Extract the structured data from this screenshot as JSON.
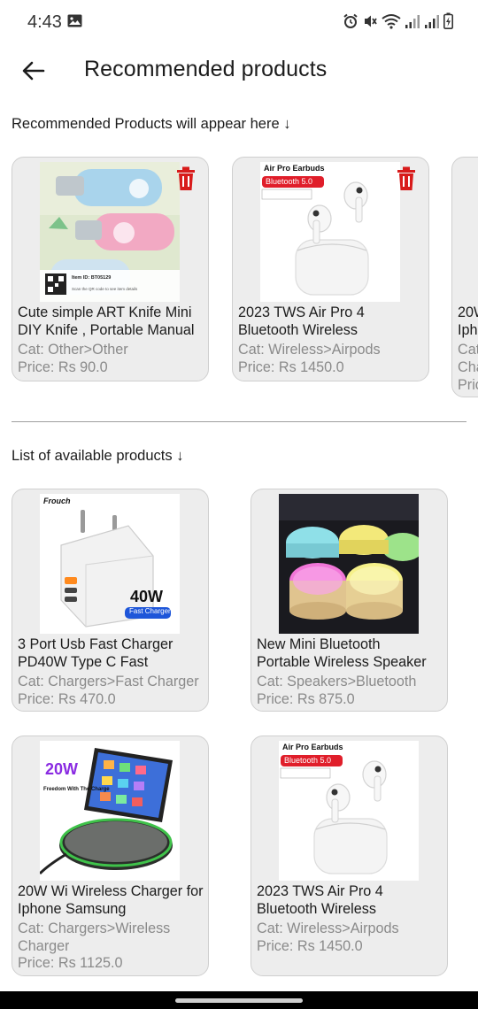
{
  "status": {
    "time": "4:43"
  },
  "header": {
    "title": "Recommended products"
  },
  "recommended": {
    "label": "Recommended Products will appear here ↓",
    "items": [
      {
        "name1": "Cute simple ART Knife Mini",
        "name2": "DIY Knife , Portable Manual",
        "cat": "Cat: Other>Other",
        "price": "Price: Rs 90.0",
        "img_text1": "Item ID: BT05129",
        "img_text2": "Scan the QR code to see item details"
      },
      {
        "name1": "2023 TWS Air Pro 4",
        "name2": "Bluetooth Wireless",
        "cat": "Cat: Wireless>Airpods",
        "price": "Price: Rs 1450.0",
        "img_title": "Air Pro Earbuds",
        "img_badge": "Bluetooth 5.0"
      },
      {
        "name1": "20W",
        "name2": "Iph",
        "cat": "Cat",
        "cat2": "Cha",
        "price": "Pric"
      }
    ]
  },
  "available": {
    "label": "List of available products ↓",
    "items": [
      {
        "name1": "3 Port Usb Fast Charger",
        "name2": "PD40W Type C Fast",
        "cat": "Cat: Chargers>Fast Charger",
        "price": "Price: Rs 470.0",
        "img_brand": "Frouch",
        "img_watt": "40W",
        "img_badge": "Fast Charger"
      },
      {
        "name1": "New Mini Bluetooth",
        "name2": "Portable Wireless Speaker",
        "cat": "Cat: Speakers>Bluetooth",
        "price": "Price: Rs 875.0"
      },
      {
        "name1": "20W Wi Wireless Charger for",
        "name2": "Iphone Samsung",
        "cat": "Cat: Chargers>Wireless",
        "cat2": "Charger",
        "price": "Price: Rs 1125.0",
        "img_watt": "20W",
        "img_tag": "Freedom With The Charge"
      },
      {
        "name1": "2023 TWS Air Pro 4",
        "name2": "Bluetooth Wireless",
        "cat": "Cat: Wireless>Airpods",
        "price": "Price: Rs 1450.0",
        "img_title": "Air Pro Earbuds",
        "img_badge": "Bluetooth 5.0"
      }
    ]
  }
}
